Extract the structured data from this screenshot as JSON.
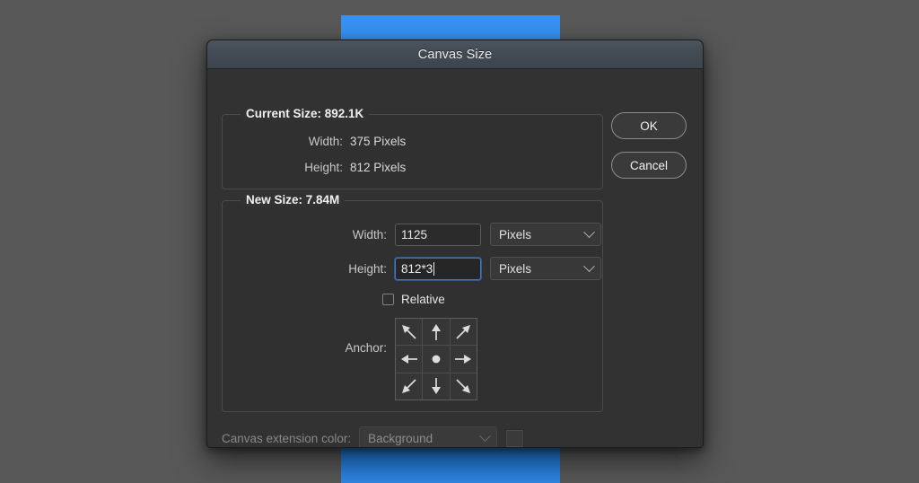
{
  "backdrop": {
    "bg_color": "#575757",
    "canvas_color": "#3892f3"
  },
  "dialog": {
    "title": "Canvas Size",
    "current_size": {
      "legend": "Current Size: 892.1K",
      "rows": [
        {
          "label": "Width:",
          "value": "375 Pixels"
        },
        {
          "label": "Height:",
          "value": "812 Pixels"
        }
      ]
    },
    "new_size": {
      "legend": "New Size: 7.84M",
      "width": {
        "label": "Width:",
        "value": "1125",
        "unit": "Pixels",
        "focused": false
      },
      "height": {
        "label": "Height:",
        "value": "812*3",
        "unit": "Pixels",
        "focused": true
      },
      "relative": {
        "label": "Relative",
        "checked": false
      },
      "anchor": {
        "label": "Anchor:",
        "selected": "center",
        "cells": [
          "arrow-up-left",
          "arrow-up",
          "arrow-up-right",
          "arrow-left",
          "center-dot",
          "arrow-right",
          "arrow-down-left",
          "arrow-down",
          "arrow-down-right"
        ]
      }
    },
    "extension": {
      "label": "Canvas extension color:",
      "value": "Background",
      "swatch_color": "#3a3a3a",
      "disabled": true
    },
    "buttons": {
      "ok": "OK",
      "cancel": "Cancel"
    }
  }
}
